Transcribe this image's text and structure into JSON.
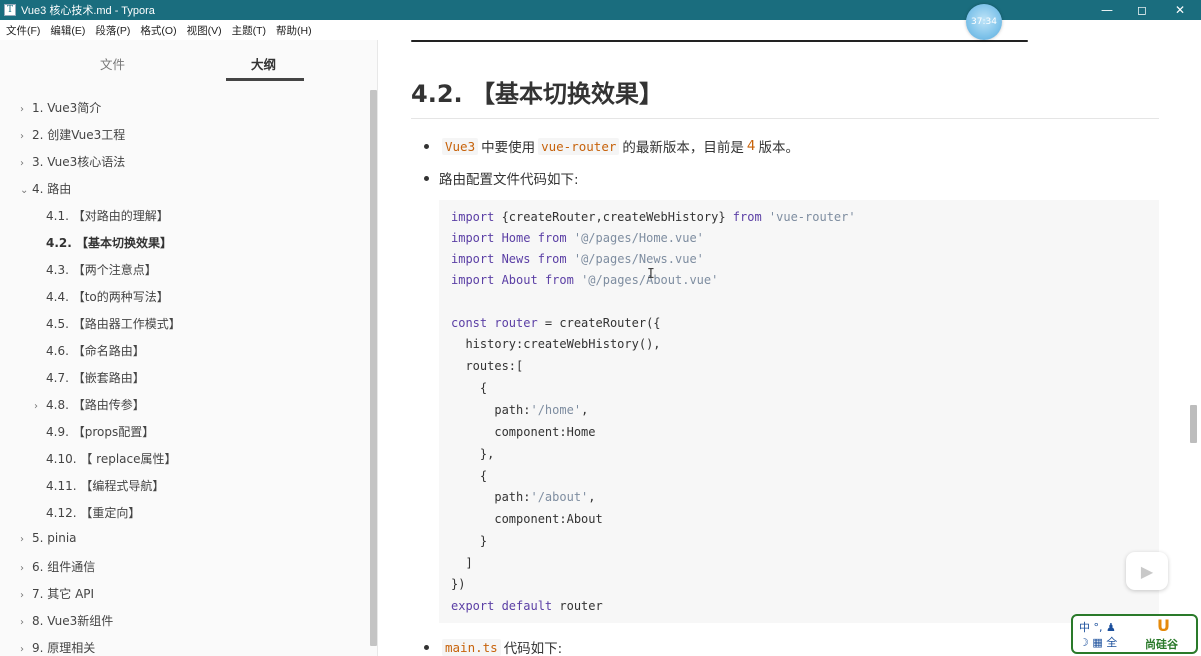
{
  "window": {
    "title": "Vue3 核心技术.md - Typora",
    "minimize": "—",
    "maximize": "◻",
    "close": "✕",
    "timer": "37:34"
  },
  "menu": [
    "文件(F)",
    "编辑(E)",
    "段落(P)",
    "格式(O)",
    "视图(V)",
    "主题(T)",
    "帮助(H)"
  ],
  "sidebar": {
    "tabs": {
      "files": "文件",
      "outline": "大纲"
    },
    "items": [
      {
        "caret": "›",
        "label": "1. Vue3简介"
      },
      {
        "caret": "›",
        "label": "2. 创建Vue3工程"
      },
      {
        "caret": "›",
        "label": "3. Vue3核心语法"
      },
      {
        "caret": "⌄",
        "label": "4. 路由"
      },
      {
        "caret": "",
        "label": "4.1. 【对路由的理解】"
      },
      {
        "caret": "",
        "label": "4.2. 【基本切换效果】"
      },
      {
        "caret": "",
        "label": "4.3. 【两个注意点】"
      },
      {
        "caret": "",
        "label": "4.4. 【to的两种写法】"
      },
      {
        "caret": "",
        "label": "4.5. 【路由器工作模式】"
      },
      {
        "caret": "",
        "label": "4.6. 【命名路由】"
      },
      {
        "caret": "",
        "label": "4.7. 【嵌套路由】"
      },
      {
        "caret": "›",
        "label": "4.8. 【路由传参】"
      },
      {
        "caret": "",
        "label": "4.9. 【props配置】"
      },
      {
        "caret": "",
        "label": "4.10. 【 replace属性】"
      },
      {
        "caret": "",
        "label": "4.11. 【编程式导航】"
      },
      {
        "caret": "",
        "label": "4.12. 【重定向】"
      },
      {
        "caret": "›",
        "label": "5. pinia"
      },
      {
        "caret": "›",
        "label": "6. 组件通信"
      },
      {
        "caret": "›",
        "label": "7. 其它 API"
      },
      {
        "caret": "›",
        "label": "8. Vue3新组件"
      },
      {
        "caret": "›",
        "label": "9. 原理相关"
      }
    ]
  },
  "content": {
    "heading": "4.2. 【基本切换效果】",
    "bullet1": {
      "code1": "Vue3",
      "text1": "中要使用",
      "code2": "vue-router",
      "text2": "的最新版本，目前是",
      "num": "4",
      "text3": "版本。"
    },
    "bullet2": "路由配置文件代码如下:",
    "code": {
      "l1": {
        "a": "import",
        "b": " {createRouter,createWebHistory} ",
        "c": "from",
        "d": " 'vue-router'"
      },
      "l2": {
        "a": "import",
        "b": " Home ",
        "c": "from",
        "d": " '@/pages/Home.vue'"
      },
      "l3": {
        "a": "import",
        "b": " News ",
        "c": "from",
        "d": " '@/pages/News.vue'"
      },
      "l4": {
        "a": "import",
        "b": " About ",
        "c": "from",
        "d": " '@/pages/About.vue'"
      },
      "l6": {
        "a": "const",
        "b": " router ",
        "c": "= createRouter({"
      },
      "l7": "  history:createWebHistory(),",
      "l8": "  routes:[",
      "l9": "    {",
      "l10": {
        "a": "      path:",
        "b": "'/home'",
        "c": ","
      },
      "l11": "      component:Home",
      "l12": "    },",
      "l13": "    {",
      "l14": {
        "a": "      path:",
        "b": "'/about'",
        "c": ","
      },
      "l15": "      component:About",
      "l16": "    }",
      "l17": "  ]",
      "l18": "})",
      "l19": {
        "a": "export default",
        "b": " router"
      }
    },
    "bullet3": {
      "code": "main.ts",
      "text": "代码如下:"
    },
    "cursor": "I"
  },
  "logo": {
    "ime": "中 °, ♟",
    "ime2": "☽ ▦ 全",
    "mark": "U",
    "brand": "尚硅谷"
  }
}
